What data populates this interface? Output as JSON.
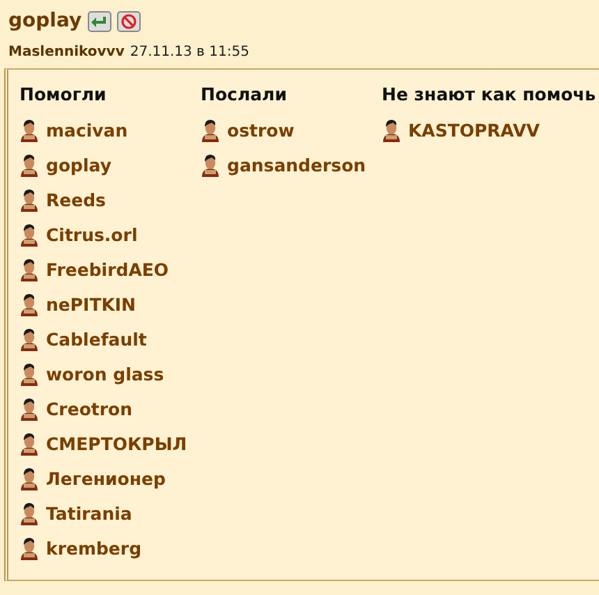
{
  "post": {
    "author": "goplay",
    "meta_author": "Maslennikovvv",
    "meta_date": "27.11.13 в 11:55"
  },
  "columns": [
    {
      "title": "Помогли",
      "users": [
        "macivan",
        "goplay",
        "Reeds",
        "Citrus.orl",
        "FreebirdAEO",
        "nePITKIN",
        "Cablefault",
        "woron glass",
        "Creotron",
        "СМЕРТОКРЫЛ",
        "Легенионер",
        "Tatirania",
        "kremberg"
      ]
    },
    {
      "title": "Послали",
      "users": [
        "ostrow",
        "gansanderson"
      ]
    },
    {
      "title": "Не знают как помочь",
      "users": [
        "KASTOPRAVV"
      ]
    }
  ]
}
